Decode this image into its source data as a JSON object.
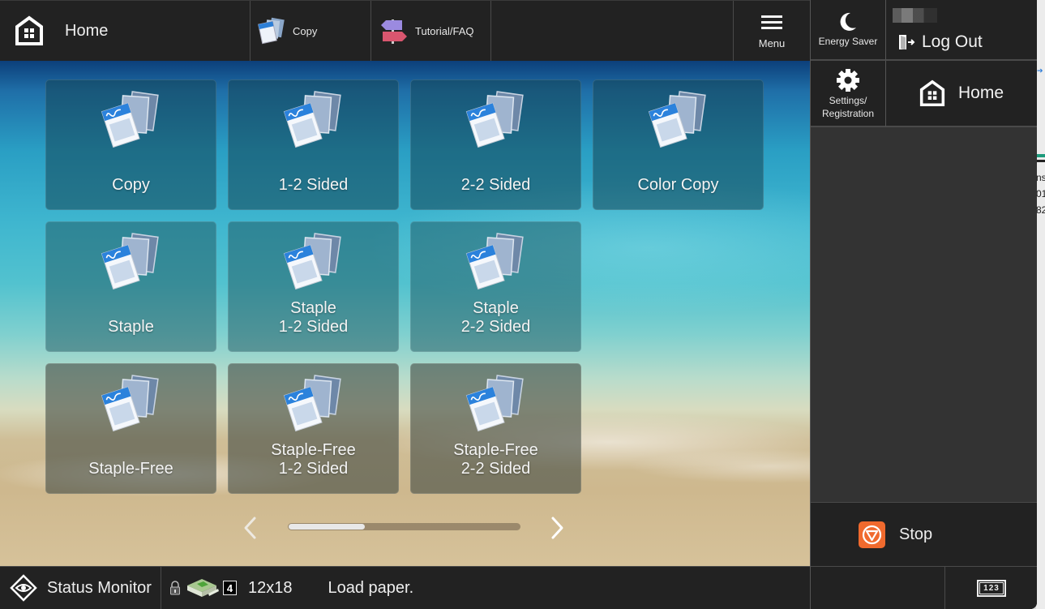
{
  "topbar": {
    "home_label": "Home",
    "shortcuts": [
      {
        "label": "Copy",
        "icon": "copy-icon"
      },
      {
        "label": "Tutorial/FAQ",
        "icon": "signpost-icon"
      }
    ],
    "menu_label": "Menu"
  },
  "right_panel": {
    "energy_saver_label": "Energy Saver",
    "logout_label": "Log Out",
    "settings_label_line1": "Settings/",
    "settings_label_line2": "Registration",
    "home_label": "Home",
    "stop_label": "Stop",
    "numeric_key_label": "123",
    "stop_color": "#f06a2e"
  },
  "tiles": [
    {
      "line1": "Copy",
      "line2": ""
    },
    {
      "line1": "1-2 Sided",
      "line2": ""
    },
    {
      "line1": "2-2 Sided",
      "line2": ""
    },
    {
      "line1": "Color Copy",
      "line2": ""
    },
    {
      "line1": "Staple",
      "line2": ""
    },
    {
      "line1": "Staple",
      "line2": "1-2 Sided"
    },
    {
      "line1": "Staple",
      "line2": "2-2 Sided"
    },
    {
      "line1": "Staple-Free",
      "line2": ""
    },
    {
      "line1": "Staple-Free",
      "line2": "1-2 Sided"
    },
    {
      "line1": "Staple-Free",
      "line2": "2-2 Sided"
    }
  ],
  "pager": {
    "scroll_position_fraction": 0.33
  },
  "statusbar": {
    "status_monitor_label": "Status Monitor",
    "tray_number": "4",
    "paper_size": "12x18",
    "message": "Load paper."
  },
  "background_window": {
    "text_fragments": [
      "ns",
      "01",
      "82"
    ]
  }
}
